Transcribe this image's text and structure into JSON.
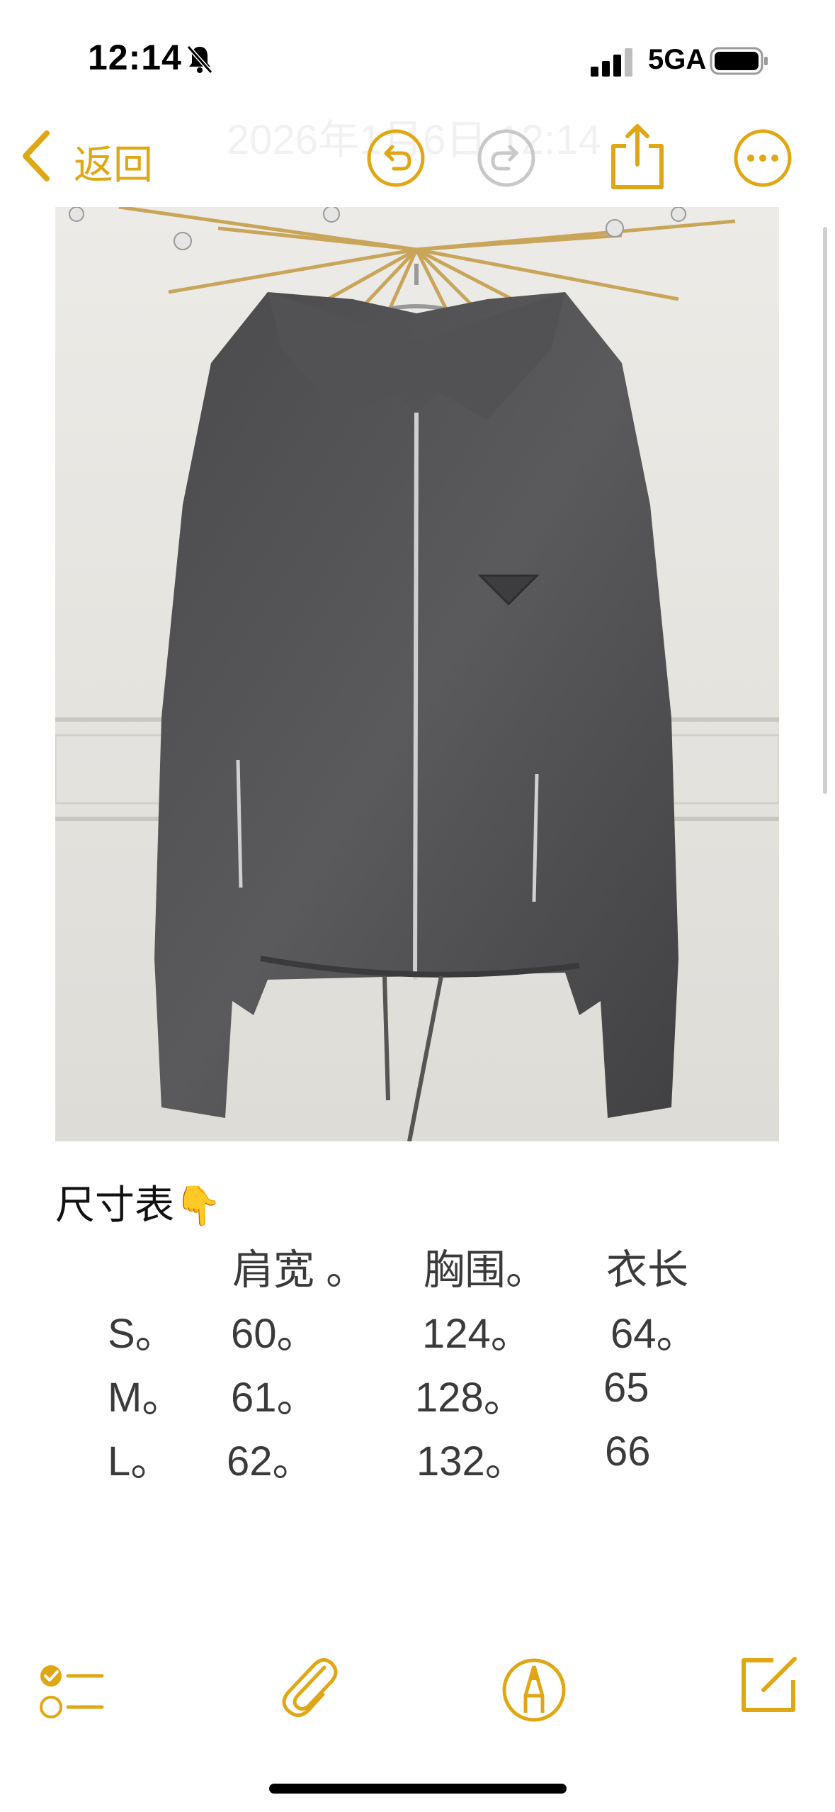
{
  "status_bar": {
    "time": "12:14",
    "network": "5GA"
  },
  "nav": {
    "back_label": "返回",
    "date_text": "2026年1月6日 12:14"
  },
  "note": {
    "title": "尺寸表",
    "pointing_emoji": "👇",
    "size_table": {
      "headers": [
        "肩宽 。",
        "胸围。",
        "衣长"
      ],
      "rows": [
        {
          "size": "S。",
          "shoulder": "60。",
          "chest": "124。",
          "length": "64。"
        },
        {
          "size": "M。",
          "shoulder": "61。",
          "chest": "128。",
          "length": "65"
        },
        {
          "size": "L。",
          "shoulder": "62。",
          "chest": "132。",
          "length": "66"
        }
      ]
    }
  },
  "icons": {
    "back": "chevron-left-icon",
    "undo": "undo-icon",
    "redo": "redo-icon",
    "share": "share-icon",
    "more": "more-icon",
    "checklist": "checklist-icon",
    "attach": "paperclip-icon",
    "markup": "markup-pen-icon",
    "compose": "compose-icon"
  },
  "colors": {
    "accent": "#e0a714",
    "disabled": "#c8c8c8",
    "text": "#3a3a3a"
  }
}
